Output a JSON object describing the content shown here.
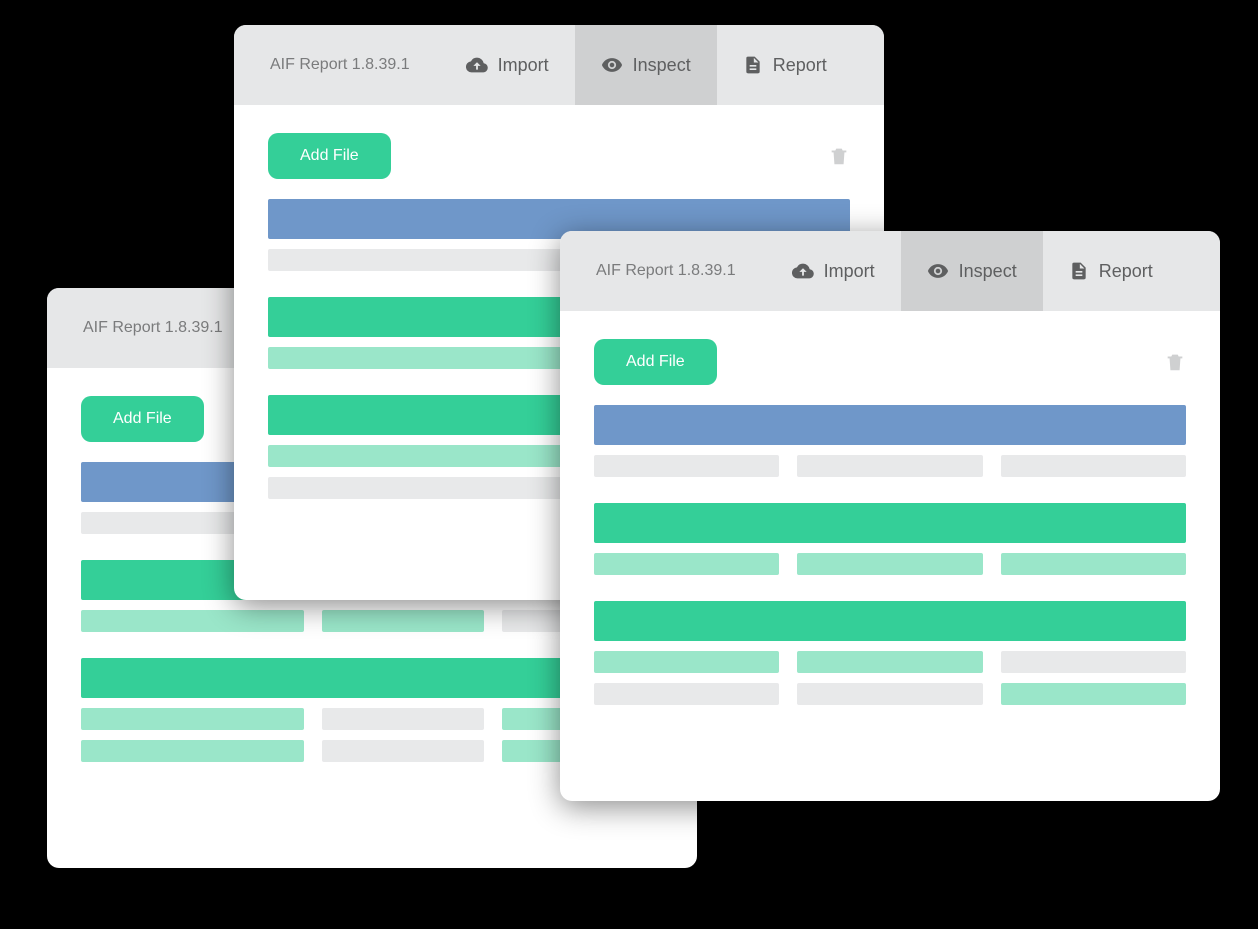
{
  "app_title": "AIF Report 1.8.39.1",
  "tabs": {
    "import": "Import",
    "inspect": "Inspect",
    "report": "Report"
  },
  "buttons": {
    "add_file": "Add File"
  }
}
